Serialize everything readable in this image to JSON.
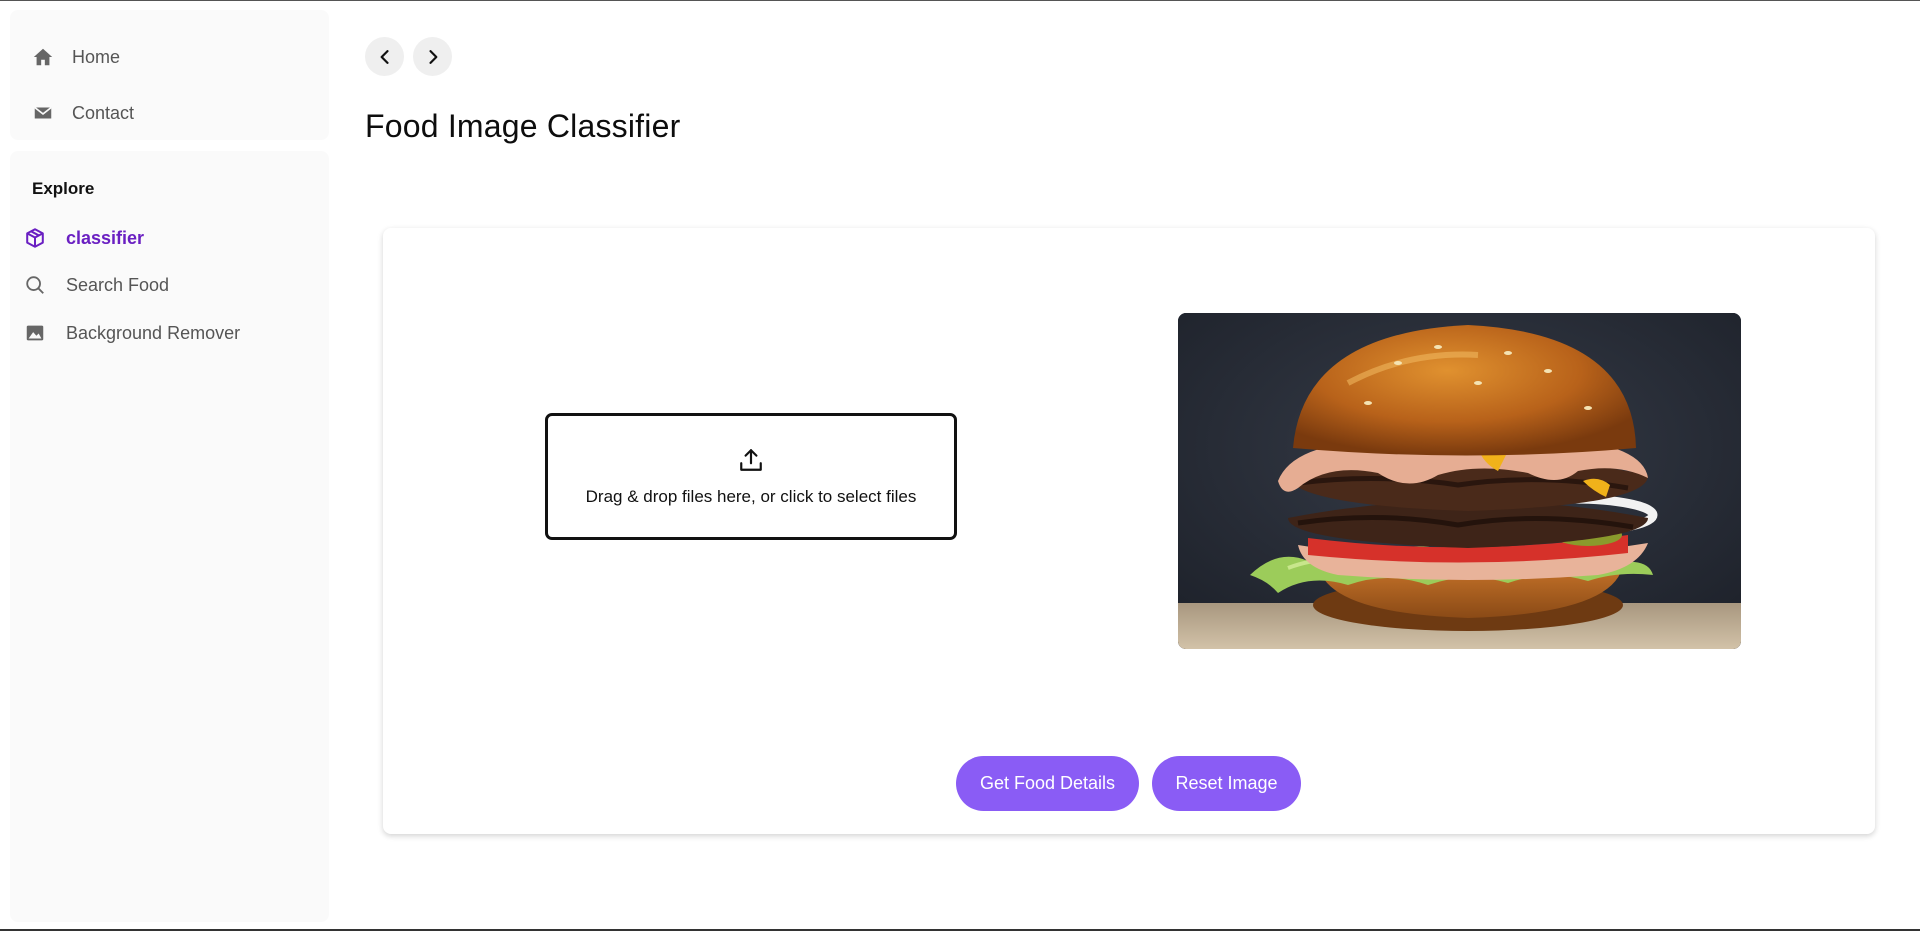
{
  "sidebar": {
    "top_items": [
      {
        "label": "Home",
        "icon": "home-icon"
      },
      {
        "label": "Contact",
        "icon": "mail-icon"
      }
    ],
    "section_title": "Explore",
    "explore_items": [
      {
        "label": "classifier",
        "icon": "cube-icon",
        "active": true
      },
      {
        "label": "Search Food",
        "icon": "search-icon",
        "active": false
      },
      {
        "label": "Background Remover",
        "icon": "image-icon",
        "active": false
      }
    ]
  },
  "header": {
    "back_icon": "chevron-left-icon",
    "forward_icon": "chevron-right-icon",
    "title": "Food Image Classifier"
  },
  "main": {
    "dropzone": {
      "icon": "upload-icon",
      "text": "Drag & drop files here, or click to select files"
    },
    "preview": {
      "subject": "burger-photo"
    },
    "buttons": {
      "details_label": "Get Food Details",
      "reset_label": "Reset Image"
    }
  },
  "colors": {
    "accent": "#8a5cf5",
    "active_nav": "#6a1fc2",
    "sidebar_bg": "#fafafa"
  }
}
